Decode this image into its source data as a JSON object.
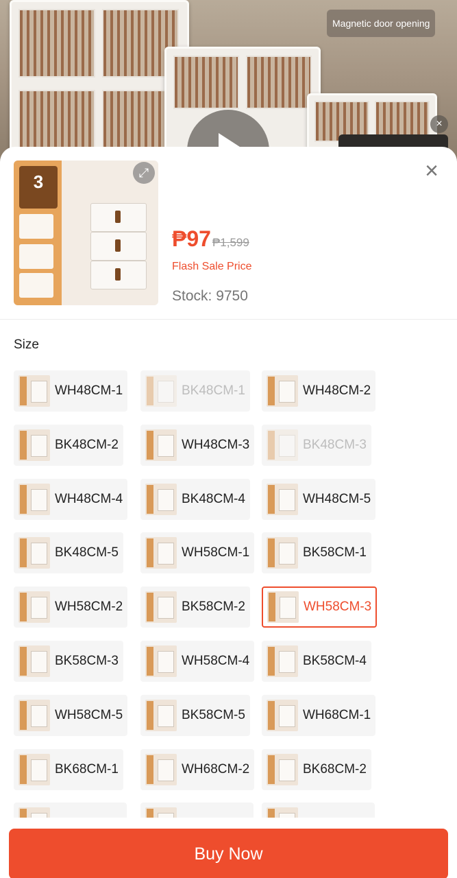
{
  "background": {
    "chip_label": "Magnetic door opening"
  },
  "product": {
    "badge_number": "3",
    "price": "₱97",
    "original_price": "₱1,599",
    "flash_label": "Flash Sale Price",
    "stock_text": "Stock: 9750"
  },
  "size": {
    "title": "Size",
    "options": [
      {
        "label": "WH48CM-1",
        "state": "normal"
      },
      {
        "label": "BK48CM-1",
        "state": "disabled"
      },
      {
        "label": "WH48CM-2",
        "state": "normal"
      },
      {
        "label": "BK48CM-2",
        "state": "normal"
      },
      {
        "label": "WH48CM-3",
        "state": "normal"
      },
      {
        "label": "BK48CM-3",
        "state": "disabled"
      },
      {
        "label": "WH48CM-4",
        "state": "normal"
      },
      {
        "label": "BK48CM-4",
        "state": "normal"
      },
      {
        "label": "WH48CM-5",
        "state": "normal"
      },
      {
        "label": "BK48CM-5",
        "state": "normal"
      },
      {
        "label": "WH58CM-1",
        "state": "normal"
      },
      {
        "label": "BK58CM-1",
        "state": "normal"
      },
      {
        "label": "WH58CM-2",
        "state": "normal"
      },
      {
        "label": "BK58CM-2",
        "state": "normal"
      },
      {
        "label": "WH58CM-3",
        "state": "selected"
      },
      {
        "label": "BK58CM-3",
        "state": "normal"
      },
      {
        "label": "WH58CM-4",
        "state": "normal"
      },
      {
        "label": "BK58CM-4",
        "state": "normal"
      },
      {
        "label": "WH58CM-5",
        "state": "normal"
      },
      {
        "label": "BK58CM-5",
        "state": "normal"
      },
      {
        "label": "WH68CM-1",
        "state": "normal"
      },
      {
        "label": "BK68CM-1",
        "state": "normal"
      },
      {
        "label": "WH68CM-2",
        "state": "normal"
      },
      {
        "label": "BK68CM-2",
        "state": "normal"
      }
    ]
  },
  "actions": {
    "buy_now_label": "Buy Now"
  },
  "colors": {
    "accent": "#ee4d2d",
    "stock_text": "#757575",
    "disabled_text": "#bdbdbd"
  }
}
